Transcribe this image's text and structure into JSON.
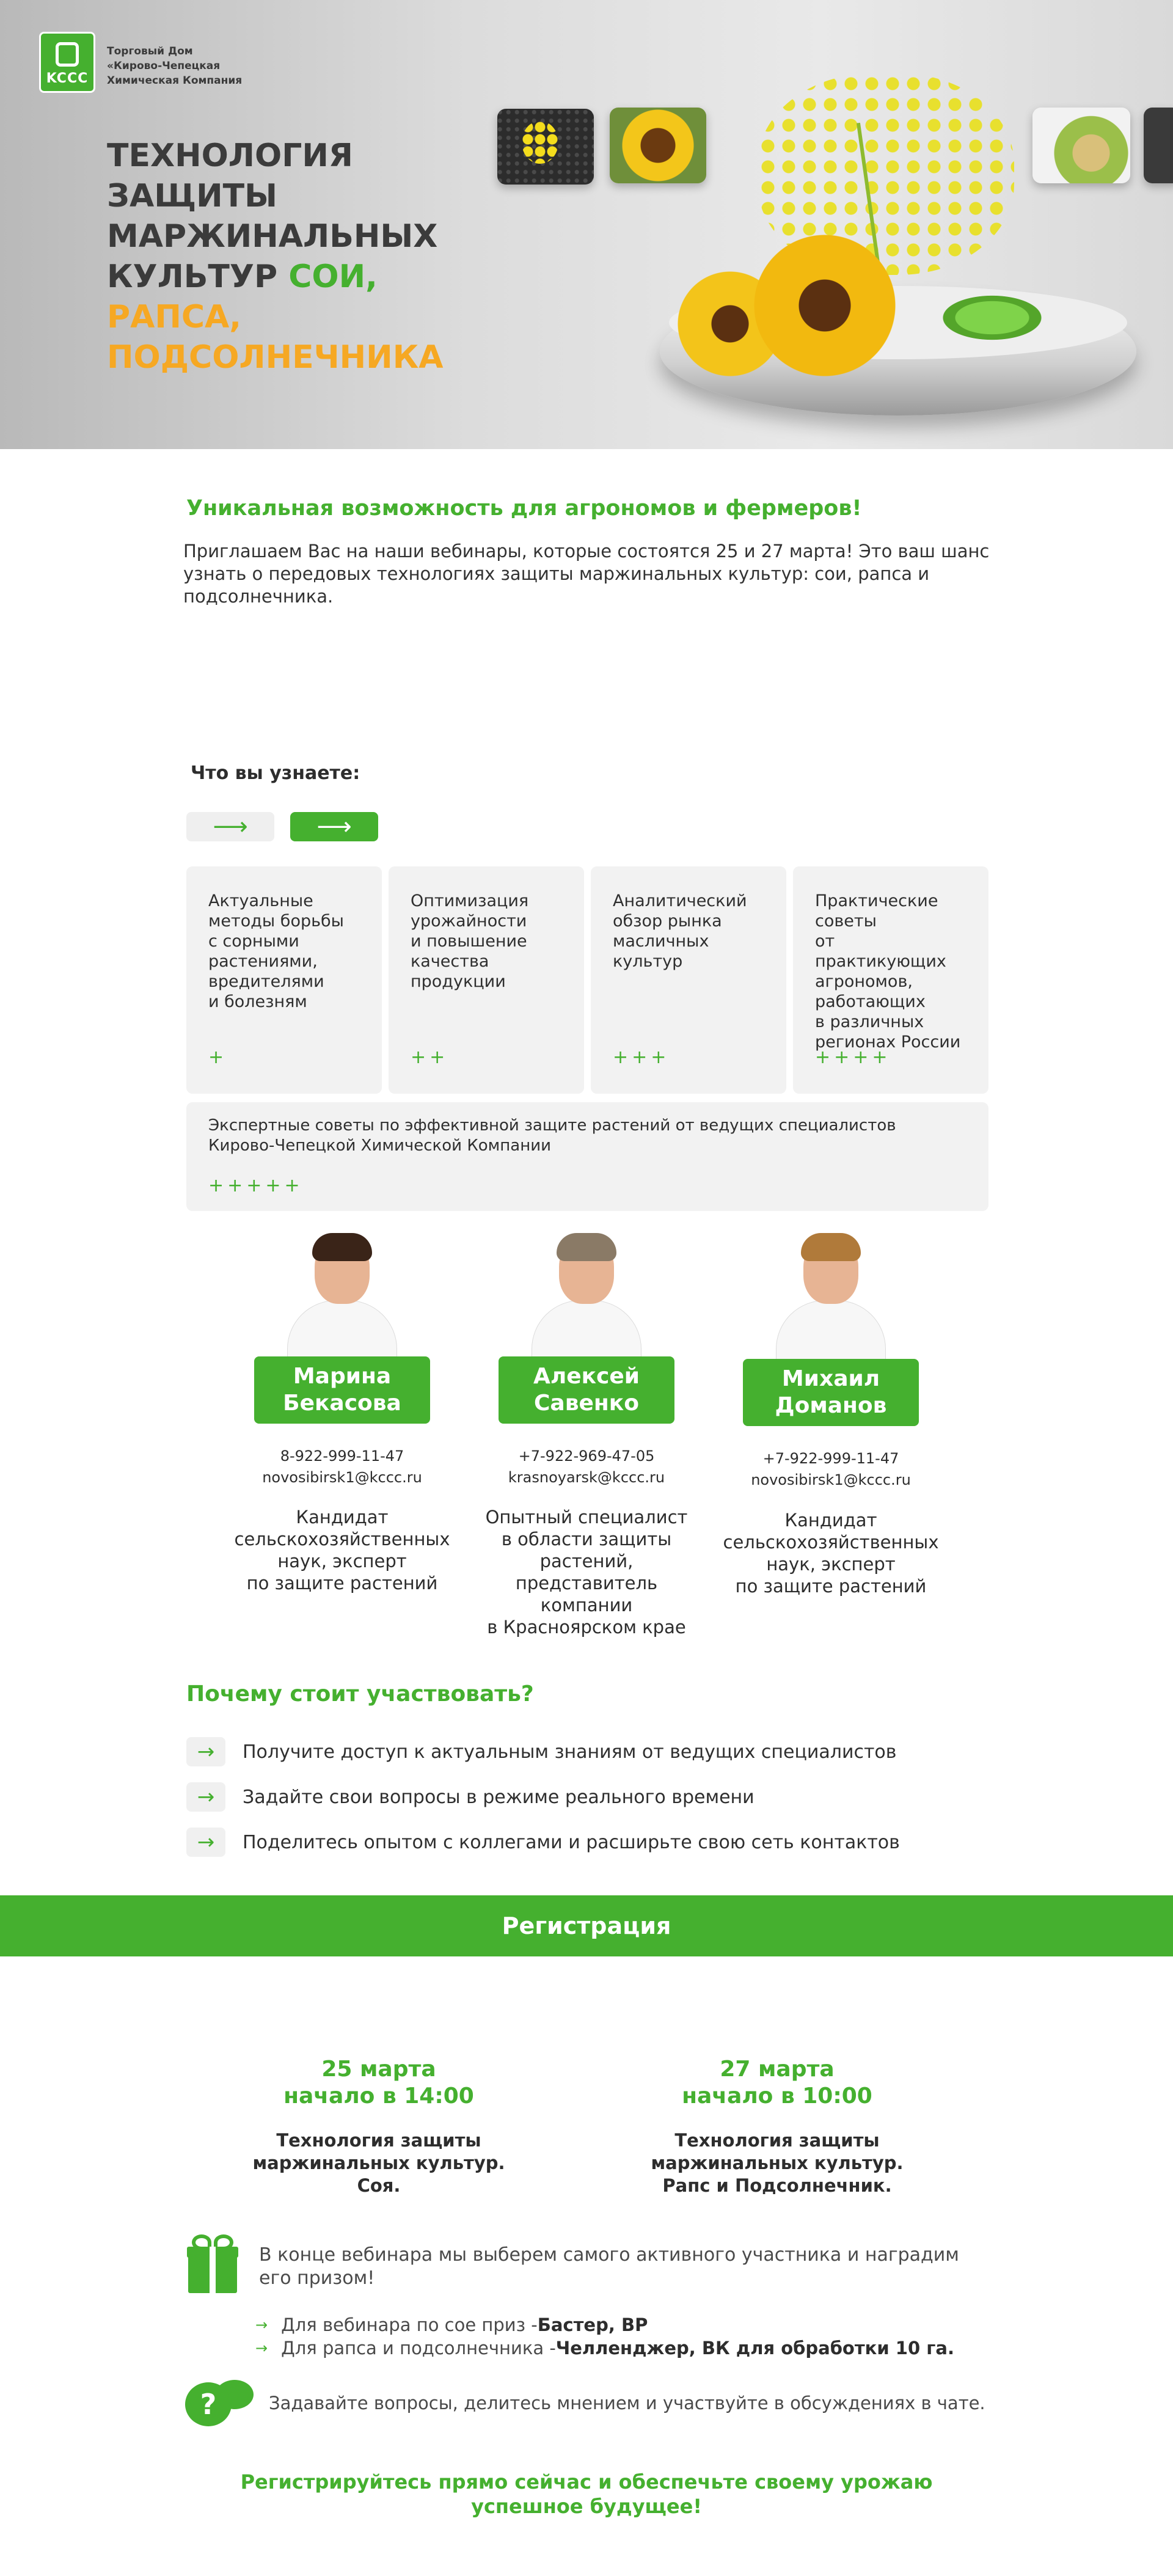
{
  "brand": {
    "logo_text": "KCCC",
    "company_lines": [
      "Торговый Дом",
      "«Кирово-Чепецкая",
      "Химическая Компания"
    ]
  },
  "hero": {
    "title_line1": "ТЕХНОЛОГИЯ",
    "title_line2": "ЗАЩИТЫ",
    "title_line3": "МАРЖИНАЛЬНЫХ",
    "title_line4_dark": "КУЛЬТУР ",
    "title_line4_green": "СОИ,",
    "title_line5": "РАПСА,",
    "title_line6": "ПОДСОЛНЕЧНИКА"
  },
  "intro": {
    "heading": "Уникальная возможность для агрономов и фермеров!",
    "text": "Приглашаем Вас на наши вебинары, которые состоятся 25 и 27 марта! Это ваш шанс узнать о передовых технологиях защиты маржинальных культур: сои, рапса и подсолнечника."
  },
  "learn": {
    "heading": "Что вы узнаете:",
    "prev_icon": "arrow-right-icon",
    "next_icon": "arrow-right-icon",
    "cards": [
      {
        "lines": [
          "Актуальные",
          "методы борьбы",
          "с сорными",
          "растениями,",
          "вредителями",
          "и болезням"
        ],
        "plus": "+"
      },
      {
        "lines": [
          "Оптимизация",
          "урожайности",
          "и повышение",
          "качества",
          "продукции"
        ],
        "plus": "++"
      },
      {
        "lines": [
          "Аналитический",
          "обзор рынка",
          "масличных",
          "культур"
        ],
        "plus": "+++"
      },
      {
        "lines": [
          "Практические",
          "советы",
          "от практикующих",
          "агрономов,",
          "работающих",
          "в различных",
          "регионах России"
        ],
        "plus": "++++"
      }
    ],
    "wide_card": {
      "lines": [
        "Экспертные советы по эффективной защите растений от ведущих специалистов",
        "Кирово-Чепецкой Химической Компании"
      ],
      "plus": "+++++"
    }
  },
  "experts": [
    {
      "name_lines": [
        "Марина",
        "Бекасова"
      ],
      "phone": "8-922-999-11-47",
      "email": "novosibirsk1@kccc.ru",
      "desc_lines": [
        "Кандидат",
        "сельскохозяйственных",
        "наук, эксперт",
        "по защите растений"
      ]
    },
    {
      "name_lines": [
        "Алексей",
        "Савенко"
      ],
      "phone": "+7-922-969-47-05",
      "email": "krasnoyarsk@kccc.ru",
      "desc_lines": [
        "Опытный специалист",
        "в области защиты",
        "растений,",
        "представитель",
        "компании",
        "в Красноярском крае"
      ]
    },
    {
      "name_lines": [
        "Михаил",
        "Доманов"
      ],
      "phone": "+7-922-999-11-47",
      "email": "novosibirsk1@kccc.ru",
      "desc_lines": [
        "Кандидат",
        "сельскохозяйственных",
        "наук, эксперт",
        "по защите растений"
      ]
    }
  ],
  "why": {
    "heading": "Почему стоит участвовать?",
    "items": [
      "Получите доступ к актуальным знаниям от ведущих специалистов",
      "Задайте свои вопросы в режиме реального времени",
      "Поделитесь опытом с коллегами и расширьте свою сеть контактов"
    ]
  },
  "registration": {
    "label": "Регистрация"
  },
  "dates": [
    {
      "date": "25 марта",
      "time": "начало в 14:00",
      "topic_lines": [
        "Технология защиты",
        "маржинальных культур.",
        "Соя."
      ]
    },
    {
      "date": "27 марта",
      "time": "начало в 10:00",
      "topic_lines": [
        "Технология защиты",
        "маржинальных культур.",
        "Рапс и Подсолнечник."
      ]
    }
  ],
  "prize": {
    "icon": "gift-icon",
    "text": "В конце вебинара мы выберем самого активного участника и наградим его призом!",
    "rows": [
      {
        "prefix": "Для вебинара по сое приз - ",
        "bold": "Бастер, ВР"
      },
      {
        "prefix": "Для рапса и подсолнечника - ",
        "bold": "Челленджер, ВК для обработки 10 га."
      }
    ]
  },
  "chat": {
    "icon": "chat-question-icon",
    "symbol": "?",
    "text": "Задавайте вопросы, делитесь мнением и участвуйте в обсуждениях в чате."
  },
  "final": {
    "lines": [
      "Регистрируйтесь прямо сейчас и обеспечьте своему урожаю",
      "успешное будущее!"
    ]
  },
  "colors": {
    "brand_green": "#45b02f",
    "accent_orange": "#f6a823",
    "card_bg": "#f2f2f2"
  }
}
